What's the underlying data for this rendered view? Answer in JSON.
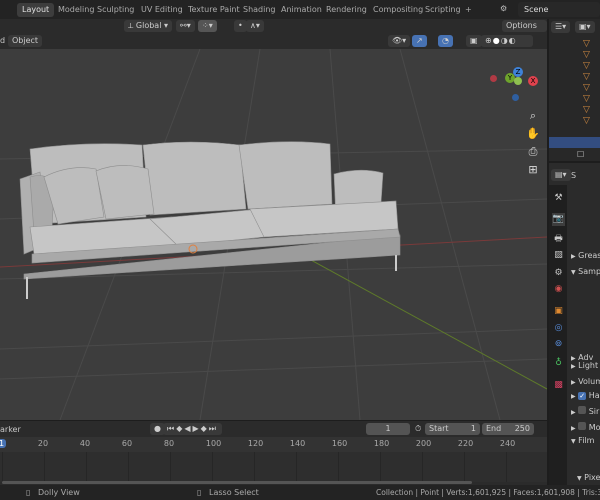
{
  "topbar": {
    "tabs": [
      "Layout",
      "Modeling",
      "Sculpting",
      "UV Editing",
      "Texture Paint",
      "Shading",
      "Animation",
      "Rendering",
      "Compositing",
      "Scripting",
      "+"
    ],
    "active_tab": "Layout",
    "scene": "Scene"
  },
  "tool_header": {
    "orientation": "Global",
    "options": "Options"
  },
  "viewport_header": {
    "menu_partial": "d",
    "object_menu": "Object"
  },
  "gizmo": {
    "x": "X",
    "y": "Y",
    "z": "Z",
    "colors": {
      "x": "#e0424d",
      "y": "#6ea42c",
      "z": "#3e82d8"
    }
  },
  "properties": {
    "header_partial": "S",
    "rows": [
      {
        "label": "Greas",
        "expanded": false
      },
      {
        "label": "Samp",
        "expanded": true
      },
      {
        "label": "Adv",
        "expanded": false
      },
      {
        "label": "Light",
        "expanded": false
      },
      {
        "label": "Volum",
        "expanded": false
      },
      {
        "label": "Ha",
        "expanded": false,
        "checkbox": true,
        "checked": true
      },
      {
        "label": "Sir",
        "expanded": false,
        "checkbox": true,
        "checked": false
      },
      {
        "label": "Mo",
        "expanded": false,
        "checkbox": true,
        "checked": false
      },
      {
        "label": "Film",
        "expanded": true
      },
      {
        "label": "Pixe",
        "expanded": true
      }
    ]
  },
  "timeline": {
    "marker_partial": "arker",
    "current_frame": "1",
    "start_label": "Start",
    "start": "1",
    "end_label": "End",
    "end": "250",
    "frame_ticks": [
      "1",
      "20",
      "40",
      "60",
      "80",
      "100",
      "120",
      "140",
      "160",
      "180",
      "200",
      "220",
      "240"
    ]
  },
  "status": {
    "left_hint": "Dolly View",
    "mid_hint": "Lasso Select",
    "stats": "Collection | Point | Verts:1,601,925 | Faces:1,601,908 | Tris:3,203,7"
  }
}
